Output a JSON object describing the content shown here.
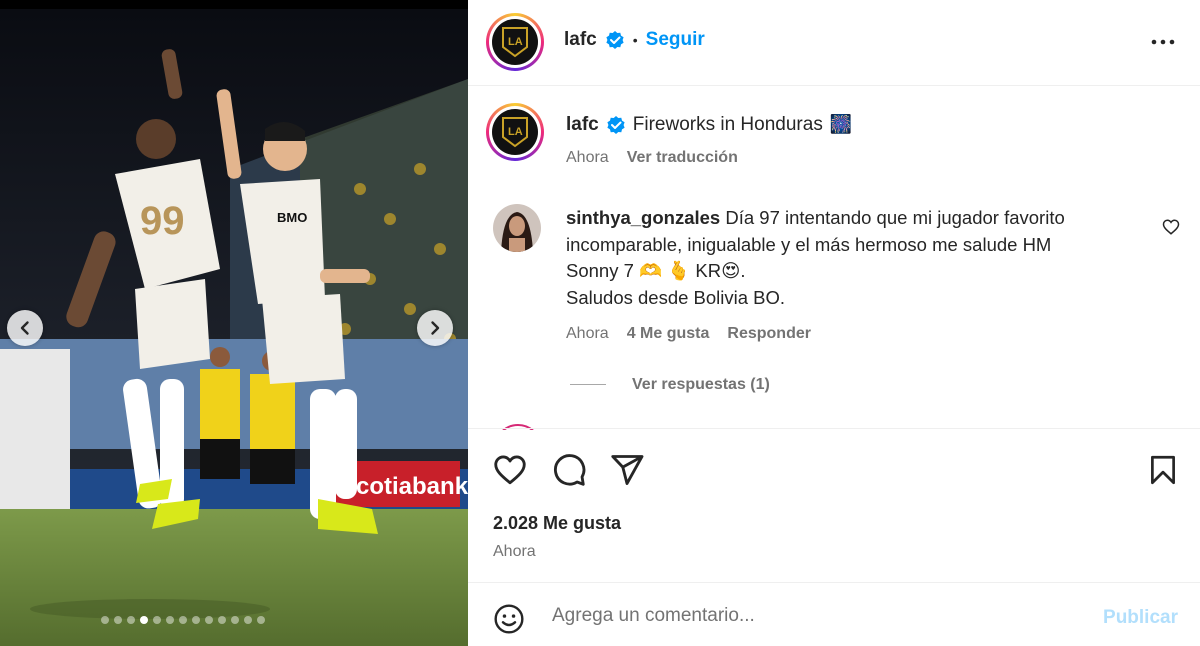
{
  "post": {
    "username": "lafc",
    "follow_label": "Seguir",
    "separator": "•",
    "more_icon": "more-horizontal-icon",
    "carousel": {
      "slide_count": 13,
      "active_slide": 4
    }
  },
  "caption": {
    "username": "lafc",
    "text": "Fireworks in Honduras",
    "emoji": "🎆",
    "time": "Ahora",
    "translate_label": "Ver traducción"
  },
  "comment": {
    "username": "sinthya_gonzales",
    "line1": "Día 97 intentando que mi jugador favorito",
    "line2": "incomparable, inigualable y el más hermoso me salude HM",
    "line3": "Sonny 7 🫶 🫰 KR😍.",
    "line4": "Saludos desde Bolivia BO.",
    "time": "Ahora",
    "likes": "4 Me gusta",
    "reply_label": "Responder",
    "view_replies": "Ver respuestas (1)"
  },
  "actions": {
    "likes": "2.028 Me gusta",
    "time": "Ahora"
  },
  "add_comment": {
    "placeholder": "Agrega un comentario...",
    "publish_label": "Publicar"
  },
  "colors": {
    "accent": "#0095f6",
    "publish_disabled": "#b2dffc",
    "verified": "#0095f6"
  }
}
